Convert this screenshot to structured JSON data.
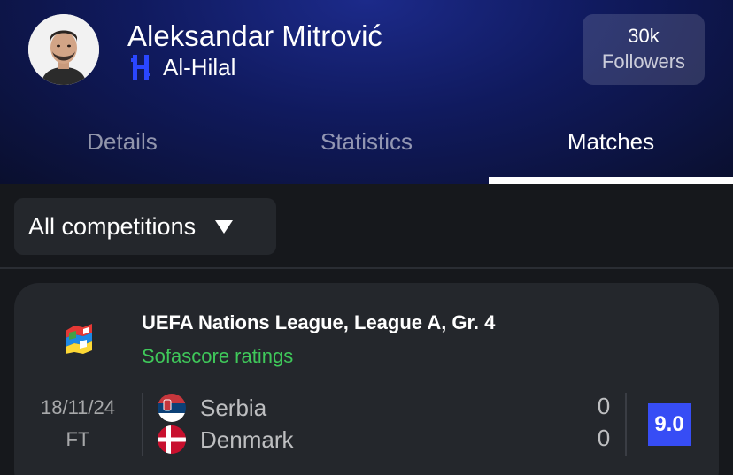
{
  "player": {
    "name": "Aleksandar Mitrović",
    "team": "Al-Hilal",
    "followers_count": "30k",
    "followers_label": "Followers"
  },
  "tabs": [
    {
      "label": "Details",
      "active": false
    },
    {
      "label": "Statistics",
      "active": false
    },
    {
      "label": "Matches",
      "active": true
    }
  ],
  "filter": {
    "selected": "All competitions"
  },
  "match_card": {
    "competition": "UEFA Nations League, League A, Gr. 4",
    "subtitle": "Sofascore ratings",
    "date": "18/11/24",
    "status": "FT",
    "home": {
      "name": "Serbia",
      "score": "0"
    },
    "away": {
      "name": "Denmark",
      "score": "0"
    },
    "rating": "9.0"
  },
  "colors": {
    "accent": "#374df5",
    "ratings_green": "#3fc85a",
    "header_blue": "#101a5e"
  },
  "icons": {
    "team_logo": "al-hilal-logo-icon",
    "competition_logo": "nations-league-logo-icon",
    "home_flag": "serbia-flag-icon",
    "away_flag": "denmark-flag-icon",
    "dropdown": "caret-down-icon"
  }
}
